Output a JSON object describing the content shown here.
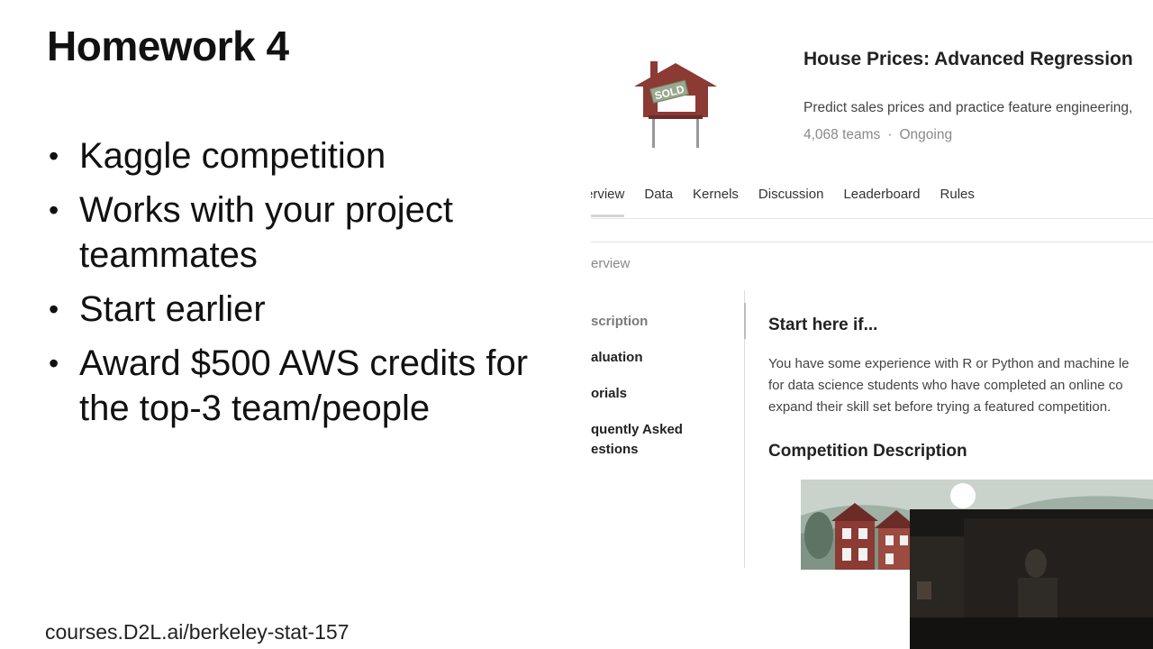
{
  "slide": {
    "title": "Homework 4",
    "bullets": [
      "Kaggle competition",
      "Works with your project teammates",
      "Start earlier",
      "Award $500 AWS credits for the top-3 team/people"
    ],
    "footer_url": "courses.D2L.ai/berkeley-stat-157"
  },
  "kaggle": {
    "competition_title": "House Prices: Advanced Regression",
    "logo_sign_text": "SOLD",
    "description": "Predict sales prices and practice feature engineering,",
    "teams": "4,068 teams",
    "status": "Ongoing",
    "separator": "·",
    "tabs": [
      "erview",
      "Data",
      "Kernels",
      "Discussion",
      "Leaderboard",
      "Rules"
    ],
    "active_tab_index": 0,
    "overview_heading": "erview",
    "sidenav": [
      "scription",
      "aluation",
      "orials",
      "quently Asked\nestions"
    ],
    "start_heading": "Start here if...",
    "start_lines": [
      "You have some experience with R or Python and machine le",
      "for data science students who have completed an online co",
      "expand their skill set before trying a featured competition."
    ],
    "competition_description_heading": "Competition Description"
  },
  "colors": {
    "house_red": "#8b3a34",
    "sign_green": "#9aa88e",
    "text_dark": "#222222",
    "text_muted": "#8a8a8a"
  }
}
